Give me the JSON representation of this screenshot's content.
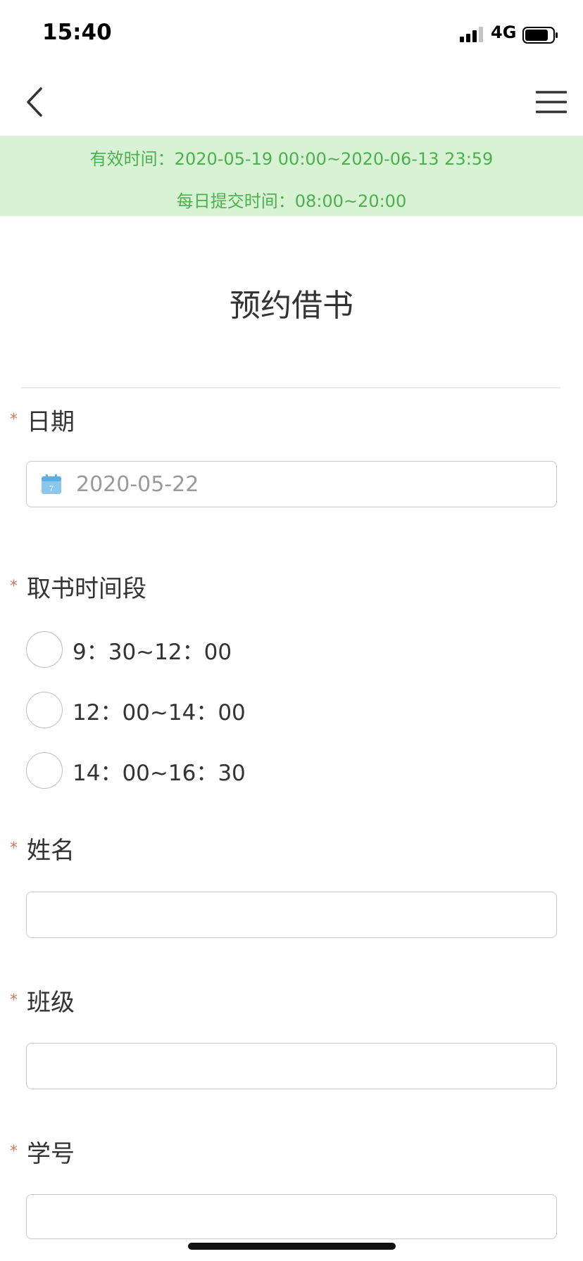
{
  "status_bar": {
    "time": "15:40",
    "network": "4G",
    "icons": [
      "signal-icon",
      "battery-icon"
    ]
  },
  "nav": {
    "icons": [
      "chevron-left-icon",
      "hamburger-menu-icon"
    ]
  },
  "banner": {
    "valid_time": "有效时间：2020-05-19 00:00~2020-06-13 23:59",
    "daily_time": "每日提交时间：08:00~20:00",
    "bg_color": "#d8f2d4",
    "text_color": "#4cb050"
  },
  "form": {
    "title": "预约借书",
    "required_mark": "*",
    "date_field": {
      "label": "日期",
      "value": "2020-05-22",
      "icon": "calendar-icon"
    },
    "time_slot_field": {
      "label": "取书时间段",
      "options": [
        "9：30~12：00",
        "12：00~14：00",
        "14：00~16：30"
      ]
    },
    "name_field": {
      "label": "姓名",
      "value": ""
    },
    "class_field": {
      "label": "班级",
      "value": ""
    },
    "student_id_field": {
      "label": "学号",
      "value": ""
    }
  },
  "colors": {
    "required_star": "#e07060",
    "input_border": "#c9c9c9"
  }
}
